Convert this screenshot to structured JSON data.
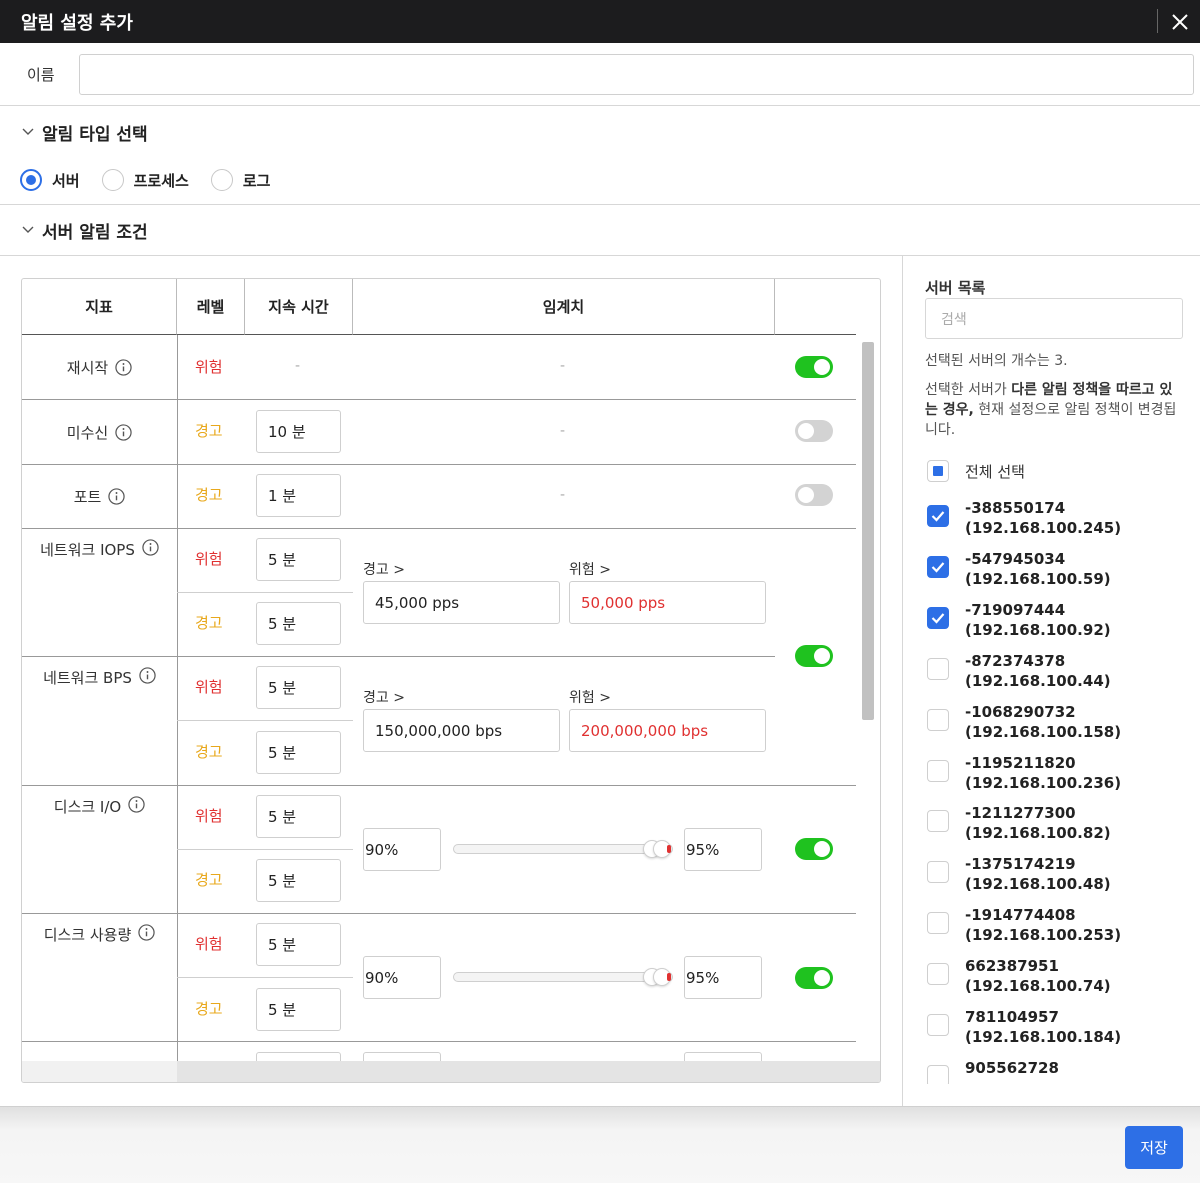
{
  "dialog": {
    "title": "알림 설정 추가"
  },
  "name_field": {
    "label": "이름",
    "value": ""
  },
  "alert_type": {
    "heading": "알림 타입 선택",
    "options": [
      {
        "label": "서버",
        "selected": true
      },
      {
        "label": "프로세스",
        "selected": false
      },
      {
        "label": "로그",
        "selected": false
      }
    ]
  },
  "conditions": {
    "heading": "서버 알림 조건",
    "columns": [
      "지표",
      "레벨",
      "지속 시간",
      "임계치",
      ""
    ],
    "threshold_warn_label": "경고 >",
    "threshold_danger_label": "위험 >",
    "dash": "-",
    "rows": [
      {
        "metric": "재시작",
        "levels": [
          {
            "level": "위험",
            "duration": ""
          }
        ],
        "enabled": true
      },
      {
        "metric": "미수신",
        "levels": [
          {
            "level": "경고",
            "duration": "10 분"
          }
        ],
        "enabled": false
      },
      {
        "metric": "포트",
        "levels": [
          {
            "level": "경고",
            "duration": "1 분"
          }
        ],
        "enabled": false
      },
      {
        "metric": "네트워크 IOPS",
        "levels": [
          {
            "level": "위험",
            "duration": "5 분"
          },
          {
            "level": "경고",
            "duration": "5 분"
          }
        ],
        "warn": "45,000 pps",
        "danger": "50,000 pps"
      },
      {
        "metric": "네트워크 BPS",
        "levels": [
          {
            "level": "위험",
            "duration": "5 분"
          },
          {
            "level": "경고",
            "duration": "5 분"
          }
        ],
        "warn": "150,000,000 bps",
        "danger": "200,000,000 bps"
      },
      {
        "metric": "디스크 I/O",
        "levels": [
          {
            "level": "위험",
            "duration": "5 분"
          },
          {
            "level": "경고",
            "duration": "5 분"
          }
        ],
        "low": "90%",
        "high": "95%",
        "enabled": true
      },
      {
        "metric": "디스크 사용량",
        "levels": [
          {
            "level": "위험",
            "duration": "5 분"
          },
          {
            "level": "경고",
            "duration": "5 분"
          }
        ],
        "low": "90%",
        "high": "95%",
        "enabled": true
      }
    ],
    "network_toggle_enabled": true
  },
  "server_panel": {
    "title": "서버 목록",
    "search_placeholder": "검색",
    "count_text": "선택된 서버의 개수는 3.",
    "note_prefix": "선택한 서버가 ",
    "note_bold": "다른 알림 정책을 따르고 있는 경우,",
    "note_suffix": " 현재 설정으로 알림 정책이 변경됩니다.",
    "select_all_label": "전체 선택",
    "servers": [
      {
        "id": "-388550174",
        "ip": "(192.168.100.245)",
        "checked": true
      },
      {
        "id": "-547945034",
        "ip": "(192.168.100.59)",
        "checked": true
      },
      {
        "id": "-719097444",
        "ip": "(192.168.100.92)",
        "checked": true
      },
      {
        "id": "-872374378",
        "ip": "(192.168.100.44)",
        "checked": false
      },
      {
        "id": "-1068290732",
        "ip": "(192.168.100.158)",
        "checked": false
      },
      {
        "id": "-1195211820",
        "ip": "(192.168.100.236)",
        "checked": false
      },
      {
        "id": "-1211277300",
        "ip": "(192.168.100.82)",
        "checked": false
      },
      {
        "id": "-1375174219",
        "ip": "(192.168.100.48)",
        "checked": false
      },
      {
        "id": "-1914774408",
        "ip": "(192.168.100.253)",
        "checked": false
      },
      {
        "id": "662387951",
        "ip": "(192.168.100.74)",
        "checked": false
      },
      {
        "id": "781104957",
        "ip": "(192.168.100.184)",
        "checked": false
      },
      {
        "id": "905562728",
        "ip": "",
        "checked": false
      }
    ]
  },
  "footer": {
    "save_label": "저장"
  },
  "colors": {
    "accent": "#2d6fe6",
    "danger": "#e03131",
    "warn": "#e8a81c",
    "toggle_on": "#1fc21f"
  }
}
